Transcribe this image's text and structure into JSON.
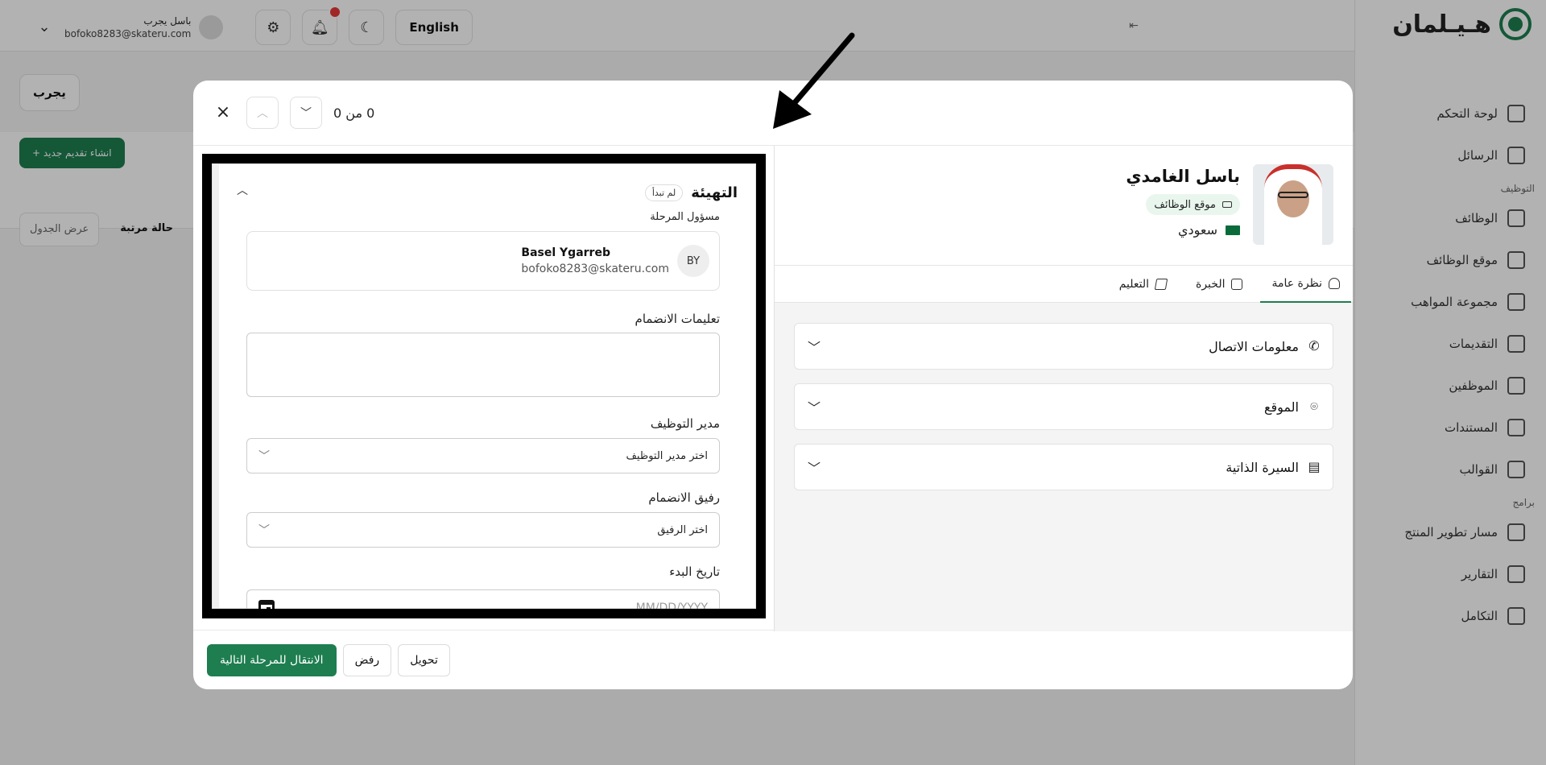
{
  "app": {
    "logo_text": "هـيـلمان",
    "language_button": "English",
    "user": {
      "name": "باسل يجرب",
      "email": "bofoko8283@skateru.com"
    },
    "filter_label": "يجرب",
    "create_label": "+ انشاء تقديم جديد",
    "table_view_label": "عرض الجدول",
    "active_tab_label": "حالة مرتبة",
    "sidebar": {
      "items_top": [
        {
          "label": "لوحة التحكم",
          "icon": "dashboard-icon"
        },
        {
          "label": "الرسائل",
          "icon": "mail-icon"
        }
      ],
      "section_jobs": "التوظيف",
      "items_jobs": [
        {
          "label": "الوظائف",
          "icon": "briefcase-icon"
        },
        {
          "label": "موقع الوظائف",
          "icon": "laptop-icon"
        },
        {
          "label": "مجموعة المواهب",
          "icon": "talent-icon"
        },
        {
          "label": "التقديمات",
          "icon": "applications-icon"
        },
        {
          "label": "الموظفين",
          "icon": "people-icon"
        },
        {
          "label": "المستندات",
          "icon": "document-icon"
        },
        {
          "label": "القوالب",
          "icon": "template-icon"
        }
      ],
      "section_programs": "برامج",
      "items_programs": [
        {
          "label": "مسار تطوير المنتج",
          "icon": "path-icon"
        },
        {
          "label": "التقارير",
          "icon": "reports-icon"
        },
        {
          "label": "التكامل",
          "icon": "integration-icon"
        }
      ]
    }
  },
  "modal": {
    "counter": "0 من 0",
    "stage": {
      "title": "التهيئة",
      "status_badge": "لم تبدأ",
      "owner_label": "مسؤول المرحلة",
      "owner": {
        "initials": "BY",
        "name": "Basel Ygarreb",
        "email": "bofoko8283@skateru.com"
      },
      "instructions_label": "تعليمات الانضمام",
      "manager_label": "مدير التوظيف",
      "manager_placeholder": "اختر مدير التوظيف",
      "buddy_label": "رفيق الانضمام",
      "buddy_placeholder": "اختر الرفيق",
      "start_date_label": "تاريخ البدء",
      "start_date_placeholder": "MM/DD/YYYY"
    },
    "candidate": {
      "name": "باسل الغامدي",
      "source": "موقع الوظائف",
      "nationality": "سعودي"
    },
    "tabs": [
      {
        "label": "نظرة عامة",
        "active": true
      },
      {
        "label": "الخبرة",
        "active": false
      },
      {
        "label": "التعليم",
        "active": false
      }
    ],
    "sections": [
      {
        "label": "معلومات الاتصال",
        "icon": "phone-icon"
      },
      {
        "label": "الموقع",
        "icon": "location-pin-icon"
      },
      {
        "label": "السيرة الذاتية",
        "icon": "document-icon"
      }
    ],
    "footer": {
      "next_stage": "الانتقال للمرحلة التالية",
      "reject": "رفض",
      "transfer": "تحويل"
    }
  },
  "colors": {
    "brand_green": "#1e7e50",
    "notification_red": "#e53935"
  }
}
